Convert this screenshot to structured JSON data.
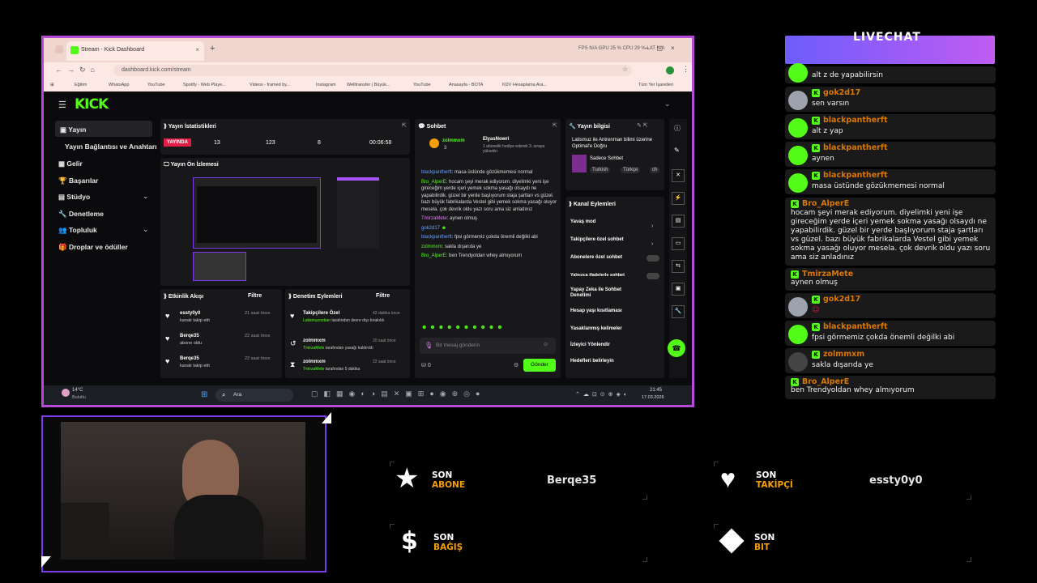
{
  "browser": {
    "tab_title": "Stream - Kick Dashboard",
    "url": "dashboard.kick.com/stream",
    "perf_stats": "FPS N/A   GPU 25 %   CPU 29 %   LAT N/A",
    "bookmarks": [
      "Eğitim",
      "WhatsApp",
      "YouTube",
      "Spotify - Web Playe...",
      "Videos - framed by...",
      "Instagram",
      "Welltransfer | Büyük...",
      "YouTube",
      "Anasayfa - BOTA",
      "KDV Hesaplama Ara..."
    ],
    "all_bookmarks": "Tüm Yer İşaretleri"
  },
  "kick": {
    "logo": "KICK",
    "sidebar": [
      {
        "label": "Yayın"
      },
      {
        "label": "Yayın Bağlantısı ve Anahtarı"
      },
      {
        "label": "Gelir"
      },
      {
        "label": "Başarılar"
      },
      {
        "label": "Stüdyo"
      },
      {
        "label": "Denetleme"
      },
      {
        "label": "Topluluk"
      },
      {
        "label": "Droplar ve ödüller"
      }
    ],
    "stats": {
      "title": "Yayın İstatistikleri",
      "live": "YAYINDA",
      "viewers": "13",
      "followers": "123",
      "subs": "8",
      "time": "00:06:58"
    },
    "preview_title": "Yayın Ön İzlemesi",
    "activity": {
      "title": "Etkinlik Akışı",
      "filter": "Filtre",
      "items": [
        {
          "user": "essty0y0",
          "text": "kanalı takip etti",
          "time": "21 saat önce"
        },
        {
          "user": "Berqe35",
          "text": "abone oldu",
          "time": "22 saat önce"
        },
        {
          "user": "Berqe35",
          "text": "kanalı takip etti",
          "time": "22 saat önce"
        }
      ]
    },
    "moderation": {
      "title": "Denetim Eylemleri",
      "filter": "Filtre",
      "items": [
        {
          "user": "Takipçilere Özel",
          "text": "tarafından devre dışı bırakıldı",
          "actor": "Latismuzooban",
          "time": "42 dakika önce"
        },
        {
          "user": "zolmmxm",
          "text": "tarafından yasağı kaldırıldı",
          "actor": "TmirzaMete",
          "time": "20 saat önce"
        },
        {
          "user": "zolmmxm",
          "text": "tarafından 5 dakika",
          "actor": "TmirzaMete",
          "time": "22 saat önce"
        }
      ]
    },
    "chat": {
      "title": "Sohbet",
      "pinned_user": "zolmmxm",
      "pinned_count": "3",
      "gift_user": "ElyasNowri",
      "gift_text": "1 abonelik hediye ederek 3. sıraya yükselin",
      "messages": [
        {
          "user": "blackpantherft",
          "text": "masa üstünde gözükmemesi normal"
        },
        {
          "user": "Bro_AlperE",
          "text": "hocam şeyi merak ediyorum. diyelimki yeni işe gireceğim yerde içeri yemek sokma yasağı olsaydı ne yapabilirdik. güzel bir yerde başlıyorum staja şartları vs güzel. bazı büyük fabrikalarda Vestel gibi yemek sokma yasağı oluyor mesela. çok devrik oldu yazı soru ama siz anladınız"
        },
        {
          "user": "TmirzaMete",
          "text": "aynen olmuş"
        },
        {
          "user": "gok2d17",
          "text": ""
        },
        {
          "user": "blackpantherft",
          "text": "fpsi görmemiz çokda önemli değilki abi"
        },
        {
          "user": "zolmmxm",
          "text": "sakla dışarıda ye"
        },
        {
          "user": "Bro_AlperE",
          "text": "ben Trendyoldan whey almıyorum"
        }
      ],
      "placeholder": "Bir mesaj gönderin",
      "send": "Gönder",
      "count": "0"
    },
    "info": {
      "title": "Yayın bilgisi",
      "stream_title": "Latismuz ile Antrenman bilimi üzerine Optimal'e Doğru",
      "category": "Sadece Sohbet",
      "tags": [
        "Turkish",
        "Türkçe",
        "ch"
      ]
    },
    "channel_actions": {
      "title": "Kanal Eylemleri",
      "items": [
        "Yavaş mod",
        "Takipçilere özel sohbet",
        "Abonelere özel sohbet",
        "Yalnızca ifadelerle sohbet",
        "Yapay Zeka ile Sohbet Denetimi",
        "Hesap yaşı kısıtlaması",
        "Yasaklanmış kelimeler",
        "İzleyici Yönlendir",
        "Hedefleri belirleyin"
      ]
    }
  },
  "taskbar": {
    "weather_temp": "14°C",
    "weather_text": "Bulutlu",
    "search": "Ara",
    "time": "21:45",
    "date": "17.03.2026"
  },
  "overlay_chat": [
    {
      "user": "",
      "text": "alt z de yapabilirsin",
      "avatar": "green"
    },
    {
      "user": "gok2d17",
      "text": "sen varsın",
      "avatar": "gray"
    },
    {
      "user": "blackpantherft",
      "text": "alt z yap",
      "avatar": "green"
    },
    {
      "user": "blackpantherft",
      "text": "aynen",
      "avatar": "green"
    },
    {
      "user": "blackpantherft",
      "text": "masa üstünde gözükmemesi normal",
      "avatar": "green"
    },
    {
      "user": "Bro_AlperE",
      "text": "hocam şeyi merak ediyorum. diyelimki yeni işe gireceğim yerde içeri yemek sokma yasağı olsaydı ne yapabilirdik. güzel bir yerde başlıyorum staja şartları vs güzel. bazı büyük fabrikalarda Vestel gibi yemek sokma yasağı oluyor mesela. çok devrik oldu yazı soru ama siz anladınız",
      "avatar": "none"
    },
    {
      "user": "TmirzaMete",
      "text": "aynen olmuş",
      "avatar": "none"
    },
    {
      "user": "gok2d17",
      "text": "",
      "avatar": "gray"
    },
    {
      "user": "blackpantherft",
      "text": "fpsi görmemiz çokda önemli değilki abi",
      "avatar": "green"
    },
    {
      "user": "zolmmxm",
      "text": "sakla dışarıda ye",
      "avatar": "dark"
    },
    {
      "user": "Bro_AlperE",
      "text": "ben Trendyoldan whey almıyorum",
      "avatar": "none"
    }
  ],
  "overlay_banner": "LIVECHAT",
  "widgets": {
    "sub": {
      "label1": "SON",
      "label2": "ABONE",
      "value": "Berqe35"
    },
    "follow": {
      "label1": "SON",
      "label2": "TAKİPÇİ",
      "value": "essty0y0"
    },
    "tip": {
      "label1": "SON",
      "label2": "BAĞIŞ",
      "value": ""
    },
    "bits": {
      "label1": "SON",
      "label2": "BIT",
      "value": ""
    }
  },
  "colors": {
    "kick_green": "#53fc18",
    "accent_orange": "#f59e0b",
    "frame_purple": "#b44ad6"
  }
}
